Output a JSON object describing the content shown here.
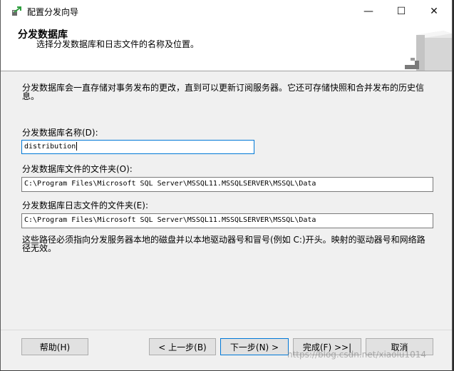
{
  "window": {
    "title": "配置分发向导",
    "minimize_glyph": "—",
    "maximize_glyph": "☐",
    "close_glyph": "✕"
  },
  "header": {
    "title": "分发数据库",
    "subtitle": "选择分发数据库和日志文件的名称及位置。"
  },
  "content": {
    "description_line1": "分发数据库会一直存储对事务发布的更改，直到可以更新订阅服务器。它还可存储快照和合并发布的历史信",
    "description_line2": "息。",
    "db_name_label": "分发数据库名称(D):",
    "db_name_value": "distribution",
    "data_folder_label": "分发数据库文件的文件夹(O):",
    "data_folder_value": "C:\\Program Files\\Microsoft SQL Server\\MSSQL11.MSSQLSERVER\\MSSQL\\Data",
    "log_folder_label": "分发数据库日志文件的文件夹(E):",
    "log_folder_value": "C:\\Program Files\\Microsoft SQL Server\\MSSQL11.MSSQLSERVER\\MSSQL\\Data",
    "note_line1": "这些路径必须指向分发服务器本地的磁盘并以本地驱动器号和冒号(例如 C:)开头。映射的驱动器号和网络路",
    "note_line2": "径无效。"
  },
  "buttons": {
    "help": "帮助(H)",
    "back": "< 上一步(B)",
    "next": "下一步(N) >",
    "finish": "完成(F) >>|",
    "cancel": "取消"
  },
  "watermark": "https://blog.csdn.net/xiaolu1014"
}
